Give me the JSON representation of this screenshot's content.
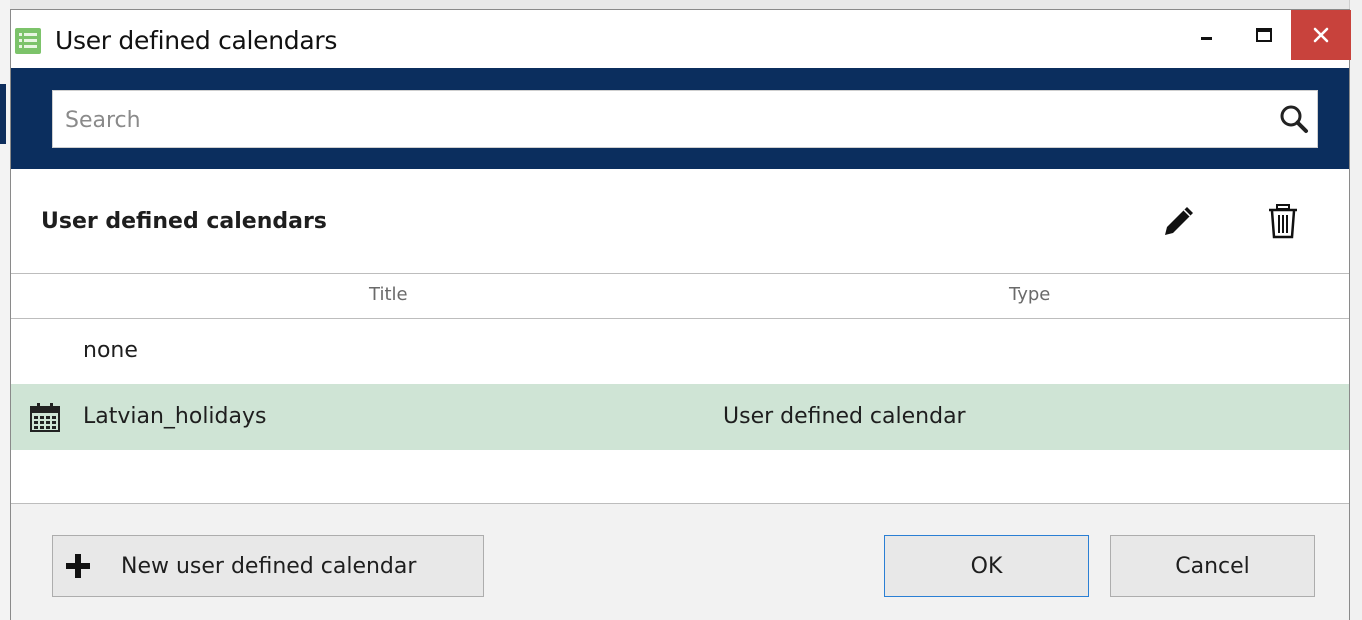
{
  "window": {
    "title": "User defined calendars",
    "controls": {
      "minimize": "minimize",
      "maximize": "maximize",
      "close": "close"
    }
  },
  "search": {
    "placeholder": "Search",
    "value": ""
  },
  "section": {
    "title": "User defined calendars",
    "actions": [
      "edit-icon",
      "delete-icon"
    ]
  },
  "table": {
    "columns": [
      "Title",
      "Type"
    ],
    "rows": [
      {
        "title": "none",
        "type": "",
        "icon": "",
        "selected": false
      },
      {
        "title": "Latvian_holidays",
        "type": "User defined calendar",
        "icon": "calendar-icon",
        "selected": true
      }
    ]
  },
  "footer": {
    "new_label": "New user defined calendar",
    "ok_label": "OK",
    "cancel_label": "Cancel"
  },
  "colors": {
    "header_bar": "#0b2e5e",
    "selected_row": "#cfe4d5",
    "close_button": "#c8423c",
    "ok_border": "#2a7fd4"
  }
}
